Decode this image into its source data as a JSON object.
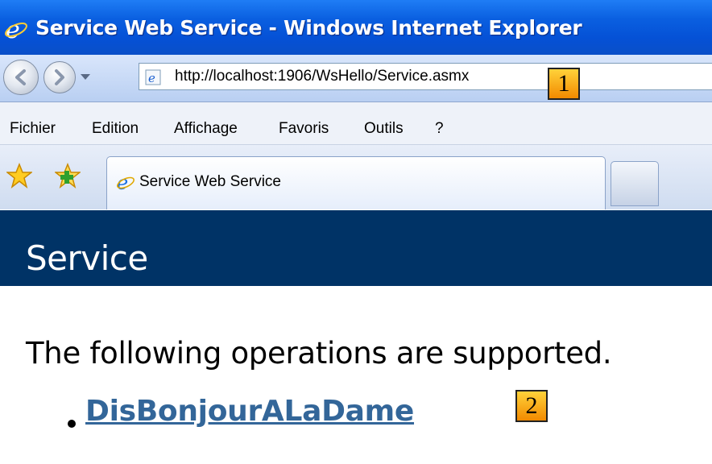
{
  "window": {
    "title": "Service Web Service - Windows Internet Explorer"
  },
  "address_bar": {
    "url": "http://localhost:1906/WsHello/Service.asmx"
  },
  "callouts": [
    "1",
    "2"
  ],
  "menu": [
    "Fichier",
    "Edition",
    "Affichage",
    "Favoris",
    "Outils",
    "?"
  ],
  "tab": {
    "label": "Service Web Service"
  },
  "page": {
    "heading": "Service",
    "intro": "The following operations are supported.",
    "operations": [
      "DisBonjourALaDame"
    ]
  },
  "colors": {
    "banner": "#003366",
    "link": "#336699",
    "titlebar": "#0a5fe0"
  }
}
